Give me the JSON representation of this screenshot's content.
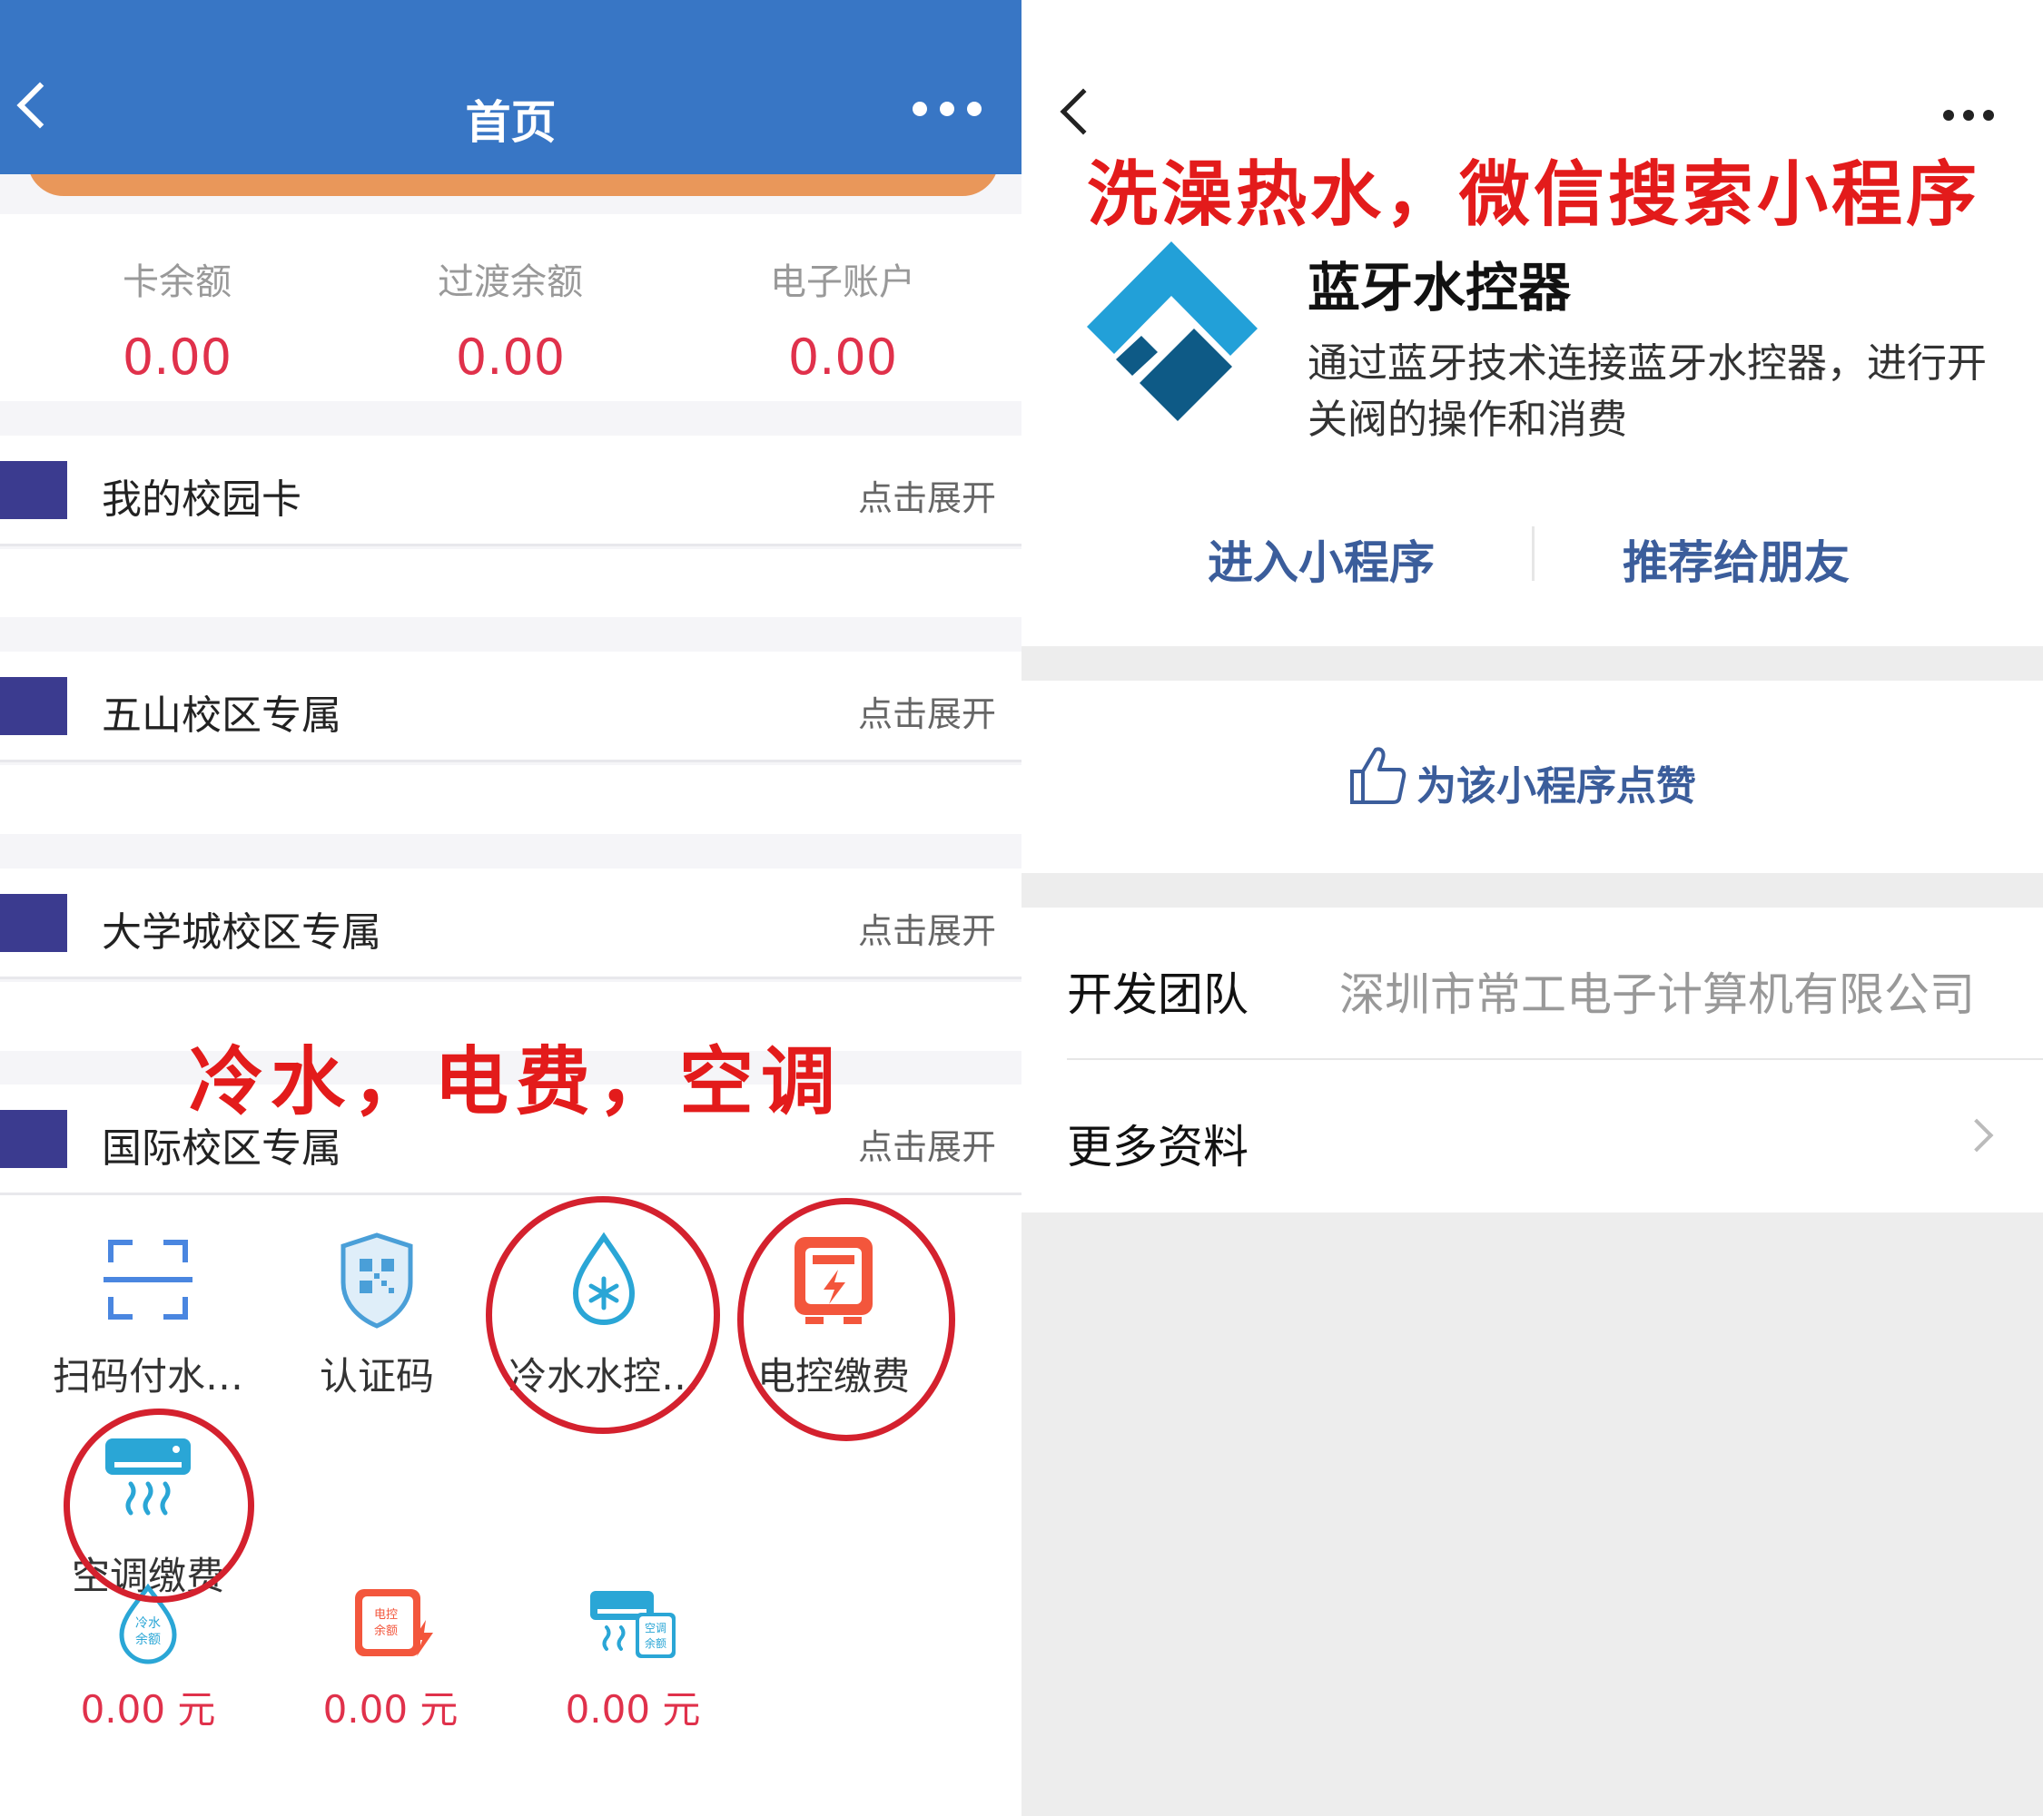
{
  "left": {
    "header": {
      "title": "首页"
    },
    "balances": [
      {
        "label": "卡余额",
        "value": "0.00"
      },
      {
        "label": "过渡余额",
        "value": "0.00"
      },
      {
        "label": "电子账户",
        "value": "0.00"
      }
    ],
    "sections": [
      {
        "name": "我的校园卡",
        "expand": "点击展开"
      },
      {
        "name": "五山校区专属",
        "expand": "点击展开"
      },
      {
        "name": "大学城校区专属",
        "expand": "点击展开"
      },
      {
        "name": "国际校区专属",
        "expand": "点击展开"
      }
    ],
    "grid": [
      {
        "label": "扫码付水…",
        "icon": "scan-icon"
      },
      {
        "label": "认证码",
        "icon": "qr-shield-icon"
      },
      {
        "label": "冷水水控…",
        "icon": "cold-water-drop-icon"
      },
      {
        "label": "电控缴费",
        "icon": "electric-meter-icon"
      },
      {
        "label": "空调缴费",
        "icon": "air-conditioner-icon"
      }
    ],
    "balance_icons": [
      {
        "icon": "cold-water-balance-icon",
        "icon_text": [
          "冷水",
          "余额"
        ],
        "amount": "0.00 元"
      },
      {
        "icon": "electric-balance-icon",
        "icon_text": [
          "电控",
          "余额"
        ],
        "amount": "0.00 元"
      },
      {
        "icon": "ac-balance-icon",
        "icon_text": [
          "空调",
          "余额"
        ],
        "amount": "0.00 元"
      }
    ],
    "annotation": "冷水，电费，空调",
    "colors": {
      "header": "#3876c5",
      "accent_red": "#e0314b",
      "section_bar": "#3b3b8f",
      "annotation": "#e31b1b"
    }
  },
  "right": {
    "annotation": "洗澡热水，微信搜索小程序",
    "app": {
      "name": "蓝牙水控器",
      "description": "通过蓝牙技术连接蓝牙水控器，进行开关阀的操作和消费"
    },
    "actions": {
      "enter": "进入小程序",
      "recommend": "推荐给朋友"
    },
    "like": "为该小程序点赞",
    "info": [
      {
        "key": "开发团队",
        "value": "深圳市常工电子计算机有限公司"
      },
      {
        "key": "更多资料",
        "value": ""
      }
    ],
    "colors": {
      "link": "#3b5d9b",
      "logo_light": "#22a0d8",
      "logo_dark": "#0e5a86"
    }
  }
}
